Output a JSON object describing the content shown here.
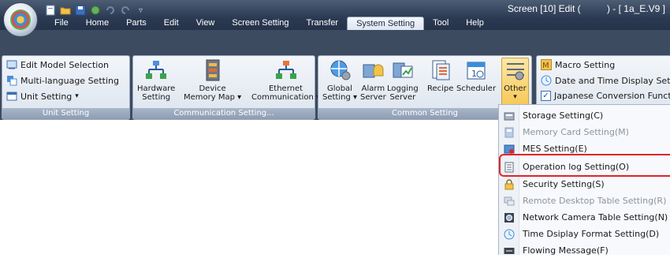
{
  "title": "Screen [10] Edit (          ) - [ 1a_E.V9 ]",
  "tabs": [
    "File",
    "Home",
    "Parts",
    "Edit",
    "View",
    "Screen Setting",
    "Transfer",
    "System Setting",
    "Tool",
    "Help"
  ],
  "active_tab": "System Setting",
  "groups": {
    "unit_setting": {
      "label": "Unit Setting",
      "items": [
        "Edit Model Selection",
        "Multi-language Setting",
        "Unit Setting"
      ],
      "dropdown_mark": "▾"
    },
    "communication": {
      "label": "Communication Setting...",
      "buttons": [
        {
          "line1": "Hardware",
          "line2": "Setting"
        },
        {
          "line1": "Device",
          "line2": "Memory Map ▾"
        },
        {
          "line1": "Ethernet",
          "line2": "Communication ▾"
        }
      ]
    },
    "common": {
      "label": "Common Setting",
      "buttons": [
        {
          "line1": "Global",
          "line2": "Setting ▾"
        },
        {
          "line1": "Alarm",
          "line2": "Server"
        },
        {
          "line1": "Logging",
          "line2": "Server"
        },
        {
          "line1": "Recipe",
          "line2": ""
        },
        {
          "line1": "Scheduler",
          "line2": ""
        },
        {
          "line1": "Other",
          "line2": "▾"
        }
      ]
    },
    "right_panel": {
      "items": [
        "Macro Setting",
        "Date and Time Display Setting",
        "Japanese Conversion Function"
      ],
      "checkmark": "✓"
    }
  },
  "menu": [
    {
      "label": "Storage Setting(C)",
      "enabled": true,
      "icon": "storage-icon"
    },
    {
      "label": "Memory Card Setting(M)",
      "enabled": false,
      "icon": "memory-card-icon"
    },
    {
      "label": "MES Setting(E)",
      "enabled": true,
      "icon": "mes-icon"
    },
    {
      "label": "Operation log Setting(O)",
      "enabled": true,
      "icon": "operation-log-icon"
    },
    {
      "label": "Security Setting(S)",
      "enabled": true,
      "icon": "lock-icon"
    },
    {
      "label": "Remote Desktop Table Setting(R)",
      "enabled": false,
      "icon": "remote-desktop-icon"
    },
    {
      "label": "Network Camera Table Setting(N)",
      "enabled": true,
      "icon": "camera-icon"
    },
    {
      "label": "Time Dsiplay Format Setting(D)",
      "enabled": true,
      "icon": "clock-icon"
    },
    {
      "label": "Flowing Message(F)",
      "enabled": true,
      "icon": "message-icon"
    }
  ],
  "colors": {
    "highlight": "#e0242b",
    "accent": "#3a8fd8"
  }
}
